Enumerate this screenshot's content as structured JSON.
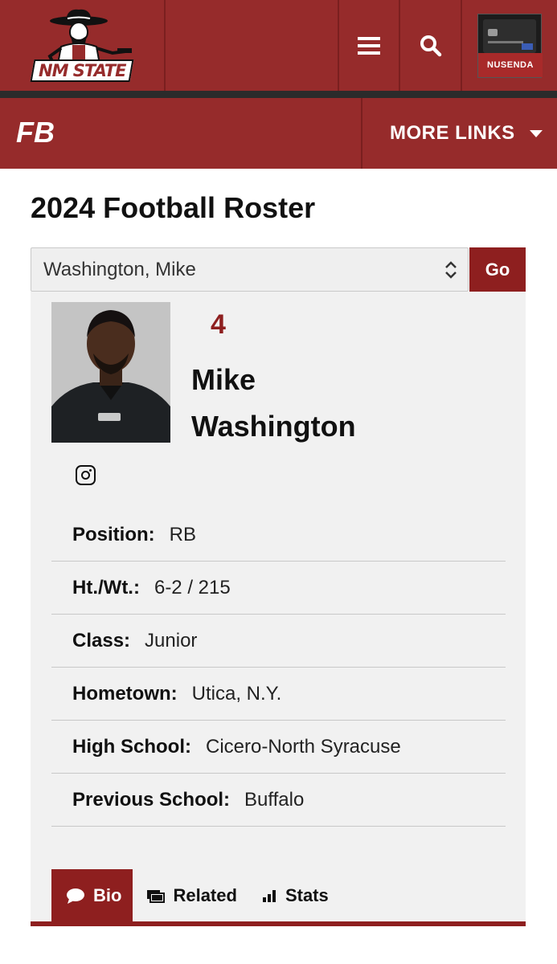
{
  "header": {
    "logo_text": "NM STATE",
    "sponsor_brand": "NUSENDA"
  },
  "subnav": {
    "section": "FB",
    "more_links": "MORE LINKS"
  },
  "page": {
    "title": "2024 Football Roster"
  },
  "roster_select": {
    "selected": "Washington, Mike",
    "go_label": "Go"
  },
  "player": {
    "number": "4",
    "first_name": "Mike",
    "last_name": "Washington",
    "details": [
      {
        "label": "Position:",
        "value": "RB"
      },
      {
        "label": "Ht./Wt.:",
        "value": "6-2 / 215"
      },
      {
        "label": "Class:",
        "value": "Junior"
      },
      {
        "label": "Hometown:",
        "value": "Utica, N.Y."
      },
      {
        "label": "High School:",
        "value": "Cicero-North Syracuse"
      },
      {
        "label": "Previous School:",
        "value": "Buffalo"
      }
    ]
  },
  "tabs": [
    {
      "label": "Bio",
      "icon": "comment-icon",
      "active": true
    },
    {
      "label": "Related",
      "icon": "cards-icon",
      "active": false
    },
    {
      "label": "Stats",
      "icon": "bar-chart-icon",
      "active": false
    }
  ],
  "colors": {
    "brand": "#962b2b",
    "accent": "#8e1f1f",
    "panel": "#f1f1f1"
  }
}
